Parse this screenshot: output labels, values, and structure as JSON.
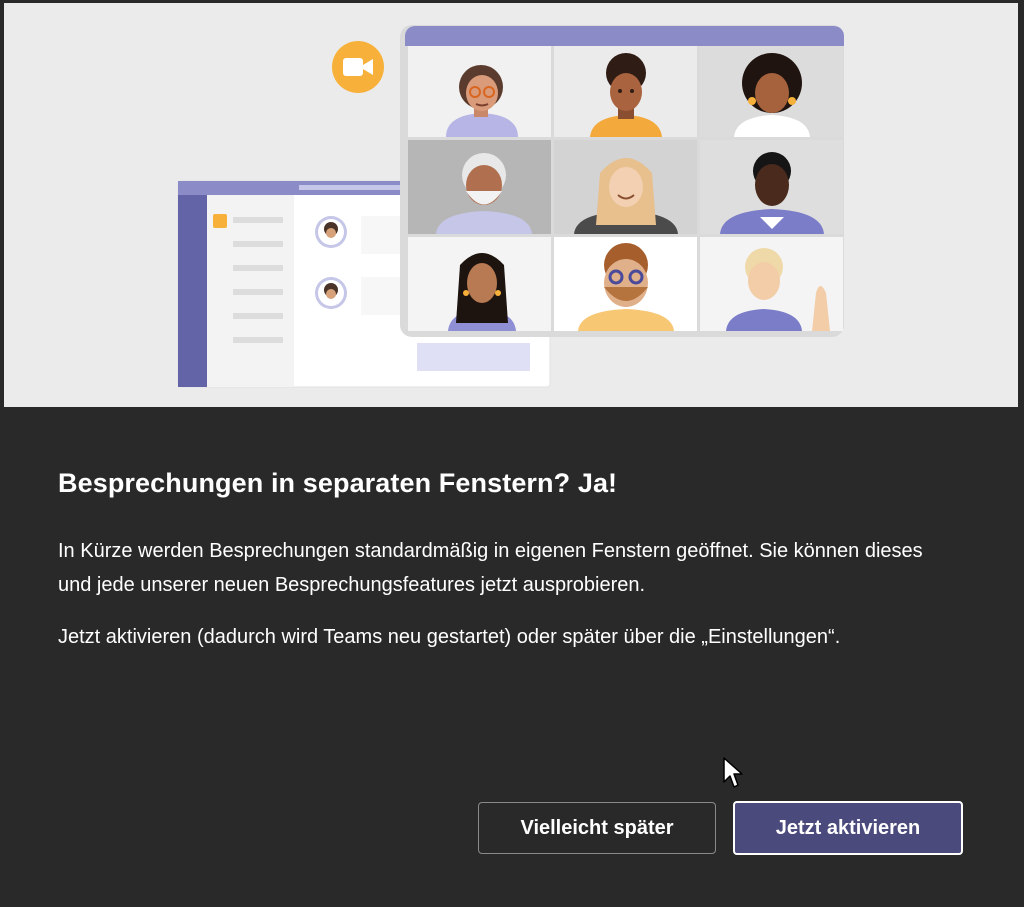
{
  "dialog": {
    "title": "Besprechungen in separaten Fenstern? Ja!",
    "paragraphs": [
      "In Kürze werden Besprechungen standardmäßig in eigenen Fenstern geöffnet. Sie können dieses und jede unserer neuen Besprechungsfeatures jetzt ausprobieren.",
      "Jetzt aktivieren (dadurch wird Teams neu gestartet) oder später über die „Einstellungen“."
    ],
    "secondary_button": "Vielleicht später",
    "primary_button": "Jetzt aktivieren"
  },
  "illustration": {
    "icons": [
      "video-camera-icon"
    ],
    "colors": {
      "accent": "#7f84c8",
      "camera_badge": "#f7b13b",
      "sidebar": "#6264a7"
    }
  },
  "colors": {
    "dialog_background": "#292929",
    "hero_background": "#ebebeb",
    "primary_button": "#4b4a7d",
    "text": "#ffffff"
  }
}
